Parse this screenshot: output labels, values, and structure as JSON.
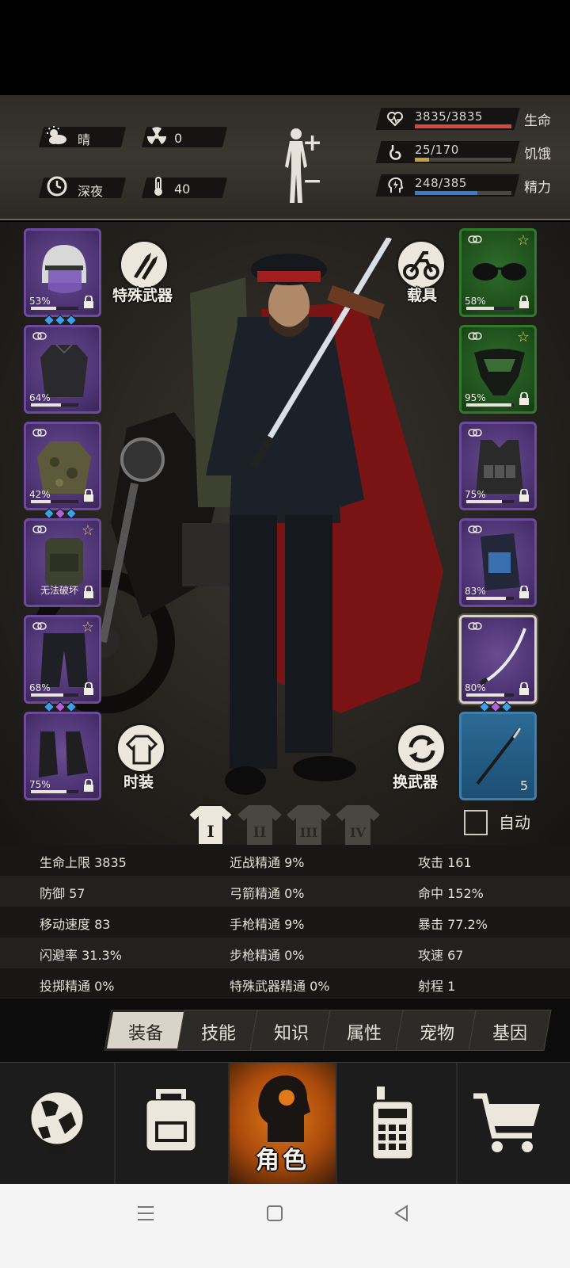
{
  "status": {
    "weather": "晴",
    "radiation": "0",
    "time_of_day": "深夜",
    "temperature": "40",
    "health": {
      "value": "3835/3835",
      "label": "生命",
      "fraction": 1.0,
      "color": "#d9483b"
    },
    "hunger": {
      "value": "25/170",
      "label": "饥饿",
      "fraction": 0.147,
      "color": "#c9a13b"
    },
    "energy": {
      "value": "248/385",
      "label": "精力",
      "fraction": 0.644,
      "color": "#3b7ad1"
    }
  },
  "equipment": {
    "left": [
      {
        "name": "helmet",
        "percent": "53%",
        "durability": 0.53,
        "gems": [
          "#3aa0e8",
          "#3aa0e8",
          "#3aa0e8"
        ]
      },
      {
        "name": "inner-shirt",
        "percent": "64%",
        "durability": 0.64
      },
      {
        "name": "camo-jacket",
        "percent": "42%",
        "durability": 0.42,
        "gems": [
          "#3aa0e8",
          "#b060d8",
          "#3aa0e8"
        ]
      },
      {
        "name": "backpack",
        "note": "无法破坏"
      },
      {
        "name": "pants",
        "percent": "68%",
        "durability": 0.68,
        "gems": [
          "#3aa0e8",
          "#b060d8",
          "#3aa0e8"
        ]
      },
      {
        "name": "boots",
        "percent": "75%",
        "durability": 0.75
      }
    ],
    "right": [
      {
        "name": "sunglasses",
        "percent": "58%",
        "durability": 0.58
      },
      {
        "name": "face-mask",
        "percent": "95%",
        "durability": 0.95
      },
      {
        "name": "tactical-vest",
        "percent": "75%",
        "durability": 0.75
      },
      {
        "name": "knee-pad",
        "percent": "83%",
        "durability": 0.83
      },
      {
        "name": "katana",
        "percent": "80%",
        "durability": 0.8,
        "gems": [
          "#3aa0e8",
          "#b060d8",
          "#3aa0e8"
        ]
      },
      {
        "name": "dart",
        "count": "5"
      }
    ]
  },
  "buttons": {
    "special_weapon": "特殊武器",
    "vehicle": "载具",
    "fashion": "时装",
    "swap_weapon": "换武器",
    "auto": "自动"
  },
  "outfit_tabs": [
    "I",
    "II",
    "III",
    "IV"
  ],
  "stats": [
    [
      "生命上限 3835",
      "近战精通 9%",
      "攻击 161"
    ],
    [
      "防御 57",
      "弓箭精通 0%",
      "命中 152%"
    ],
    [
      "移动速度 83",
      "手枪精通 9%",
      "暴击 77.2%"
    ],
    [
      "闪避率 31.3%",
      "步枪精通 0%",
      "攻速 67"
    ],
    [
      "投掷精通 0%",
      "特殊武器精通 0%",
      "射程 1"
    ]
  ],
  "tabs": [
    "装备",
    "技能",
    "知识",
    "属性",
    "宠物",
    "基因"
  ],
  "active_tab": 0,
  "bottom_nav": {
    "items": [
      "world-map",
      "backpack",
      "character",
      "radio",
      "shop"
    ],
    "active_label": "角色"
  }
}
